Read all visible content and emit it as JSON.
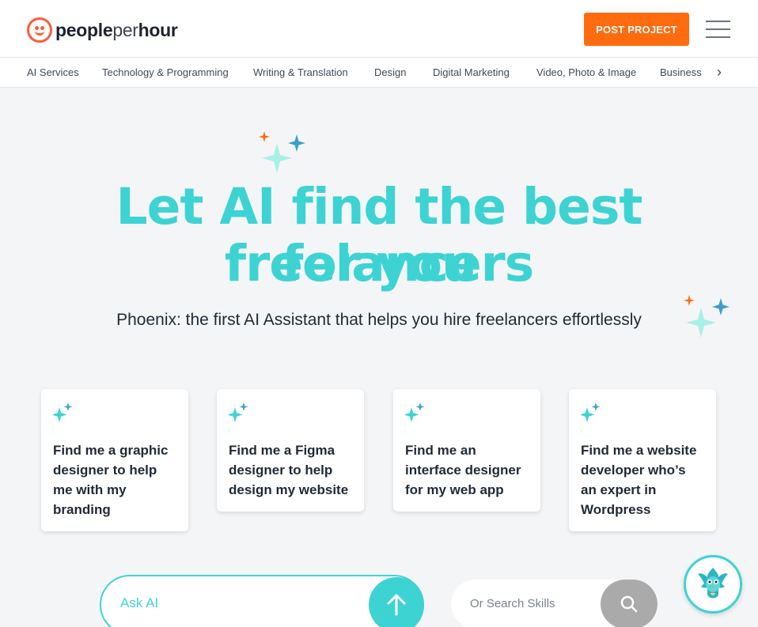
{
  "header": {
    "logo": {
      "word1": "people",
      "word2": "per",
      "word3": "hour"
    },
    "post_project_label": "POST PROJECT"
  },
  "categories": [
    "AI Services",
    "Technology & Programming",
    "Writing & Translation",
    "Design",
    "Digital Marketing",
    "Video, Photo & Image",
    "Business"
  ],
  "hero": {
    "title_line1": "Let AI find the best freelancers",
    "title_line2": "for you",
    "subtitle": "Phoenix: the first AI Assistant that helps you hire freelancers effortlessly"
  },
  "cards": [
    "Find me a graphic designer to help me with my branding",
    "Find me a Figma designer to help design my website",
    "Find me an interface designer for my web app",
    "Find me a website developer who’s an expert in Wordpress"
  ],
  "ask": {
    "placeholder": "Ask AI"
  },
  "search": {
    "placeholder": "Or Search Skills"
  },
  "colors": {
    "brand_orange": "#ff6b0f",
    "logo_red": "#ff5a36",
    "teal": "#3dd3d3",
    "mint": "#a8f0e6",
    "blue_spark": "#3aa0c8"
  },
  "icons": [
    "sparkle-icon",
    "hamburger-menu-icon",
    "chevron-right-icon",
    "arrow-up-icon",
    "search-icon",
    "phoenix-mascot-icon"
  ]
}
